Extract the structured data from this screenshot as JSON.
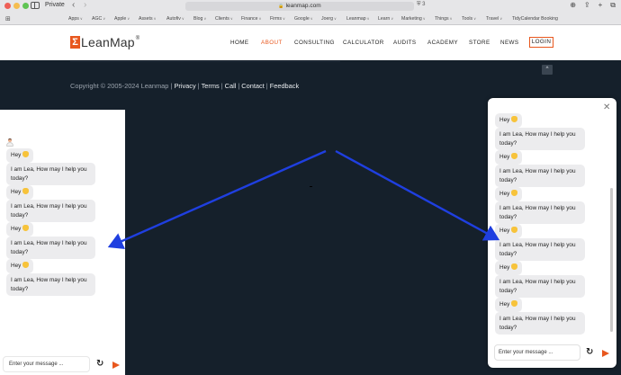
{
  "browser": {
    "private_label": "Private",
    "url": "leanmap.com",
    "shield_count": "3",
    "bookmarks": [
      {
        "label": "Apps"
      },
      {
        "label": "AGC"
      },
      {
        "label": "Apple"
      },
      {
        "label": "Assets"
      },
      {
        "label": "Autofiv"
      },
      {
        "label": "Blog"
      },
      {
        "label": "Clients"
      },
      {
        "label": "Finance"
      },
      {
        "label": "Firms"
      },
      {
        "label": "Google"
      },
      {
        "label": "Joerg"
      },
      {
        "label": "Leanmap"
      },
      {
        "label": "Learn"
      },
      {
        "label": "Marketing"
      },
      {
        "label": "Things"
      },
      {
        "label": "Tools"
      },
      {
        "label": "Travel"
      },
      {
        "label": "TidyCalendar Booking"
      }
    ]
  },
  "header": {
    "logo_text": "LeanMap",
    "logo_reg": "®",
    "nav": [
      {
        "label": "HOME"
      },
      {
        "label": "ABOUT"
      },
      {
        "label": "CONSULTING"
      },
      {
        "label": "CALCULATOR"
      },
      {
        "label": "AUDITS"
      },
      {
        "label": "ACADEMY"
      },
      {
        "label": "STORE"
      },
      {
        "label": "NEWS"
      }
    ],
    "login": "LOGIN",
    "active_color": "#e8571e"
  },
  "footer": {
    "copyright": "Copyright © 2005-2024 Leanmap |",
    "links": [
      "Privacy",
      "Terms",
      "Call",
      "Contact",
      "Feedback"
    ],
    "to_top": "^"
  },
  "chat_left": {
    "messages": [
      {
        "text": "Hey",
        "emoji": "wave-emoji"
      },
      {
        "text": "I am Lea, How may I help you today?"
      },
      {
        "text": "Hey",
        "emoji": "wave-emoji"
      },
      {
        "text": "I am Lea, How may I help you today?"
      },
      {
        "text": "Hey",
        "emoji": "wave-emoji"
      },
      {
        "text": "I am Lea, How may I help you today?"
      },
      {
        "text": "Hey",
        "emoji": "wave-emoji"
      },
      {
        "text": "I am Lea, How may I help you today?"
      }
    ],
    "input_placeholder": "Enter your message ..."
  },
  "chat_right": {
    "messages": [
      {
        "text": "Hey",
        "emoji": "wave-emoji"
      },
      {
        "text": "I am Lea, How may I help you today?"
      },
      {
        "text": "Hey",
        "emoji": "wave-emoji"
      },
      {
        "text": "I am Lea, How may I help you today?"
      },
      {
        "text": "Hey",
        "emoji": "wave-emoji"
      },
      {
        "text": "I am Lea, How may I help you today?"
      },
      {
        "text": "Hey",
        "emoji": "wave-emoji"
      },
      {
        "text": "I am Lea, How may I help you today?"
      },
      {
        "text": "Hey",
        "emoji": "wave-emoji"
      },
      {
        "text": "I am Lea, How may I help you today?"
      },
      {
        "text": "Hey",
        "emoji": "wave-emoji"
      },
      {
        "text": "I am Lea, How may I help you today?"
      }
    ],
    "input_placeholder": "Enter your message ...",
    "close": "✕"
  },
  "colors": {
    "accent": "#e8571e",
    "arrow": "#1f3fe0",
    "footer_bg": "#15202b"
  }
}
